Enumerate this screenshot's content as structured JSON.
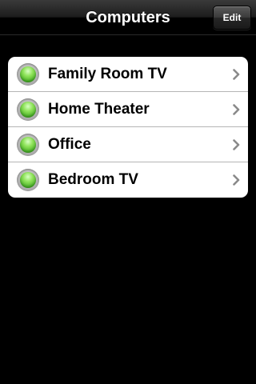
{
  "navbar": {
    "title": "Computers",
    "edit_label": "Edit"
  },
  "computers": [
    {
      "name": "Family Room TV",
      "status": "online",
      "status_color": "#5cc42f",
      "icon": "chevron-right-icon"
    },
    {
      "name": "Home Theater",
      "status": "online",
      "status_color": "#5cc42f",
      "icon": "chevron-right-icon"
    },
    {
      "name": "Office",
      "status": "online",
      "status_color": "#5cc42f",
      "icon": "chevron-right-icon"
    },
    {
      "name": "Bedroom TV",
      "status": "online",
      "status_color": "#5cc42f",
      "icon": "chevron-right-icon"
    }
  ],
  "colors": {
    "background": "#000000",
    "row_background": "#ffffff",
    "status_green": "#5cc42f",
    "chevron": "#8a8a8a"
  }
}
